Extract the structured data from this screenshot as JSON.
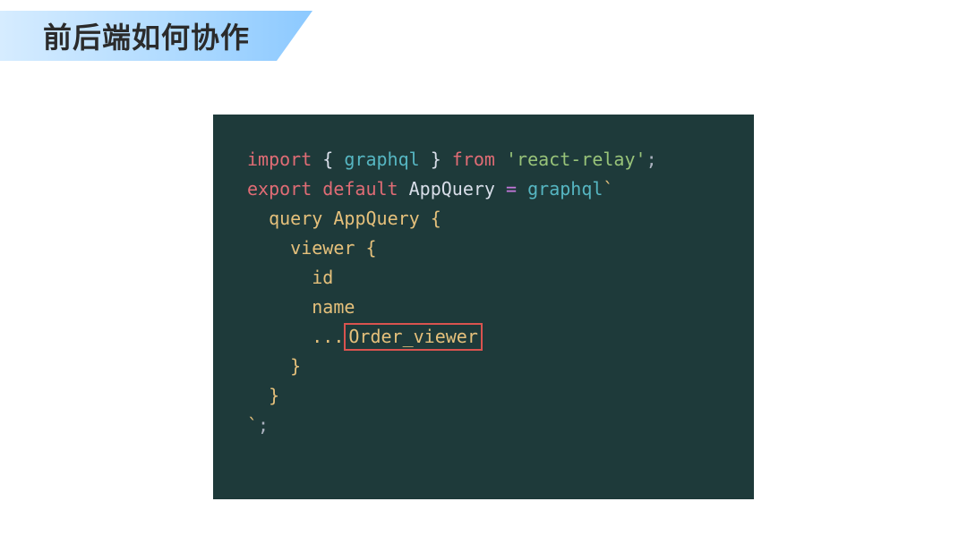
{
  "header": {
    "title": "前后端如何协作"
  },
  "code": {
    "line1": {
      "kw1": "import",
      "brace_l": " { ",
      "fn": "graphql",
      "brace_r": " } ",
      "kw2": "from",
      "sp": " ",
      "str": "'react-relay'",
      "semi": ";"
    },
    "line2": "",
    "line3": {
      "kw1": "export",
      "sp1": " ",
      "kw2": "default",
      "sp2": " ",
      "id": "AppQuery",
      "sp3": " ",
      "op": "=",
      "sp4": " ",
      "fn": "graphql",
      "tick": "`"
    },
    "line4": {
      "indent": "  ",
      "k": "query",
      "sp": " ",
      "name": "AppQuery",
      "sp2": " ",
      "brace": "{"
    },
    "line5": {
      "indent": "    ",
      "name": "viewer",
      "sp": " ",
      "brace": "{"
    },
    "line6": {
      "indent": "      ",
      "field": "id"
    },
    "line7": {
      "indent": "      ",
      "field": "name"
    },
    "line8": {
      "indent": "      ",
      "dots": "...",
      "frag": "Order_viewer"
    },
    "line9": {
      "indent": "    ",
      "brace": "}"
    },
    "line10": {
      "indent": "  ",
      "brace": "}"
    },
    "line11": {
      "tick": "`",
      "semi": ";"
    }
  }
}
